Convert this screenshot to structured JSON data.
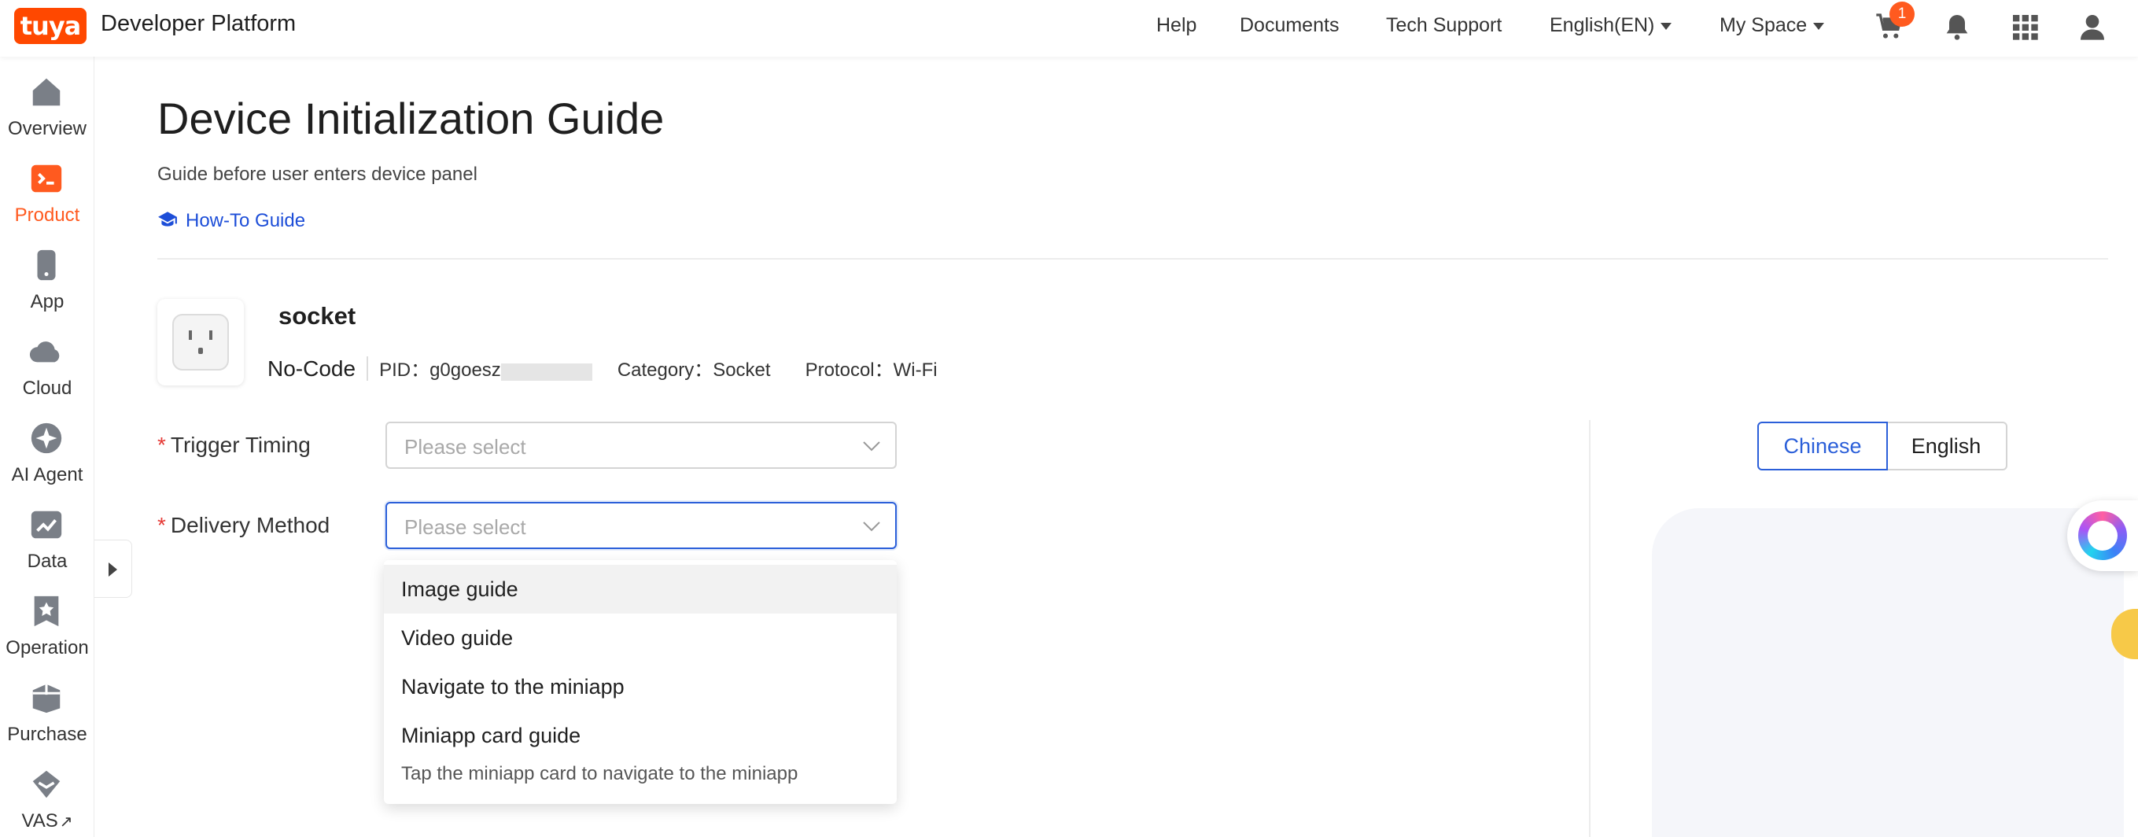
{
  "topbar": {
    "logo_text": "tuya",
    "brand": "Developer Platform",
    "links": {
      "help": "Help",
      "documents": "Documents",
      "tech_support": "Tech Support",
      "language": "English(EN)",
      "my_space": "My Space"
    },
    "cart_count": "1",
    "accent_color": "#ff4800"
  },
  "sidebar": {
    "items": [
      {
        "label": "Overview",
        "icon": "home-icon"
      },
      {
        "label": "Product",
        "icon": "product-terminal-icon",
        "active": true
      },
      {
        "label": "App",
        "icon": "phone-icon"
      },
      {
        "label": "Cloud",
        "icon": "cloud-icon"
      },
      {
        "label": "AI Agent",
        "icon": "ai-sparkle-icon"
      },
      {
        "label": "Data",
        "icon": "chart-icon"
      },
      {
        "label": "Operation",
        "icon": "star-bookmark-icon"
      },
      {
        "label": "Purchase",
        "icon": "box-icon"
      },
      {
        "label": "VAS",
        "icon": "diamond-icon",
        "external": "↗"
      }
    ]
  },
  "page": {
    "title": "Device Initialization Guide",
    "subtitle": "Guide before user enters device panel",
    "howto": "How-To Guide"
  },
  "product": {
    "name": "socket",
    "mode": "No-Code",
    "pid": "PID：g0goesz",
    "category": "Category：Socket",
    "protocol": "Protocol：Wi-Fi"
  },
  "form": {
    "trigger_label": "Trigger Timing",
    "trigger_placeholder": "Please select",
    "delivery_label": "Delivery Method",
    "delivery_placeholder": "Please select",
    "required_mark": "*"
  },
  "dropdown": {
    "options": [
      "Image guide",
      "Video guide",
      "Navigate to the miniapp",
      "Miniapp card guide"
    ],
    "note": "Tap the miniapp card to navigate to the miniapp"
  },
  "preview": {
    "lang_zh": "Chinese",
    "lang_en": "English"
  }
}
